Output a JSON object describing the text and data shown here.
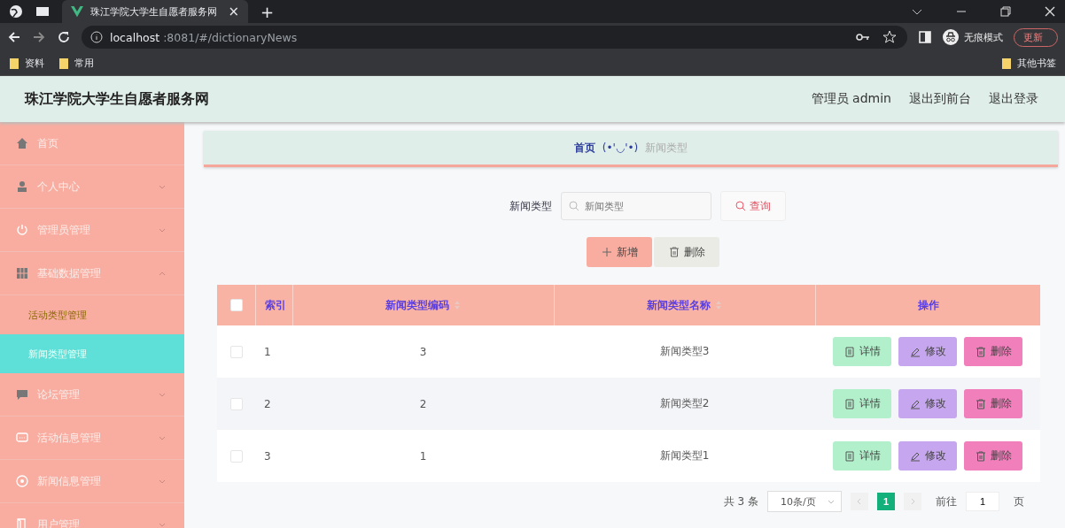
{
  "browser": {
    "tabs": [
      {
        "title": "珠江学院大学生自愿者服务网",
        "selected": true
      }
    ],
    "close_glyph": "×",
    "new_tab_glyph": "+",
    "address": {
      "host": "localhost",
      "rest": ":8081/#/dictionaryNews"
    },
    "incognito": "无痕模式",
    "update": "更新",
    "bookmarks": [
      "资料",
      "常用"
    ],
    "other_bookmarks": "其他书签"
  },
  "header": {
    "title": "珠江学院大学生自愿者服务网",
    "links": [
      "管理员 admin",
      "退出到前台",
      "退出登录"
    ]
  },
  "sidebar": {
    "items": [
      {
        "label": "首页"
      },
      {
        "label": "个人中心",
        "expanded": false
      },
      {
        "label": "管理员管理",
        "expanded": false
      },
      {
        "label": "基础数据管理",
        "expanded": true,
        "children": [
          {
            "label": "活动类型管理",
            "selected": false
          },
          {
            "label": "新闻类型管理",
            "selected": true
          }
        ]
      },
      {
        "label": "论坛管理",
        "expanded": false
      },
      {
        "label": "活动信息管理",
        "expanded": false
      },
      {
        "label": "新闻信息管理",
        "expanded": false
      },
      {
        "label": "用户管理",
        "expanded": false
      }
    ]
  },
  "breadcrumb": {
    "home": "首页",
    "separator": "(•'◡'•)",
    "current": "新闻类型"
  },
  "search": {
    "label": "新闻类型",
    "placeholder": "新闻类型",
    "button": "查询"
  },
  "actions": [
    {
      "kind": "add",
      "label": "新增"
    },
    {
      "kind": "delete",
      "label": "删除"
    }
  ],
  "table": {
    "select_all": false,
    "columns": [
      "索引",
      "新闻类型编码",
      "新闻类型名称",
      "操作"
    ],
    "rows": [
      {
        "checked": false,
        "cells": [
          "1",
          "3",
          "新闻类型3"
        ],
        "buttons": [
          {
            "kind": "detail",
            "label": "详情"
          },
          {
            "kind": "edit",
            "label": "修改"
          },
          {
            "kind": "delete",
            "label": "删除"
          }
        ]
      },
      {
        "checked": false,
        "cells": [
          "2",
          "2",
          "新闻类型2"
        ],
        "buttons": [
          {
            "kind": "detail",
            "label": "详情"
          },
          {
            "kind": "edit",
            "label": "修改"
          },
          {
            "kind": "delete",
            "label": "删除"
          }
        ]
      },
      {
        "checked": false,
        "cells": [
          "3",
          "1",
          "新闻类型1"
        ],
        "buttons": [
          {
            "kind": "detail",
            "label": "详情"
          },
          {
            "kind": "edit",
            "label": "修改"
          },
          {
            "kind": "delete",
            "label": "删除"
          }
        ]
      }
    ]
  },
  "pagination": {
    "total": "共 3 条",
    "page_size": "10条/页",
    "pages": [
      {
        "label": "1",
        "selected": true
      }
    ],
    "goto": "前往",
    "goto_value": "1",
    "page_unit": "页"
  }
}
